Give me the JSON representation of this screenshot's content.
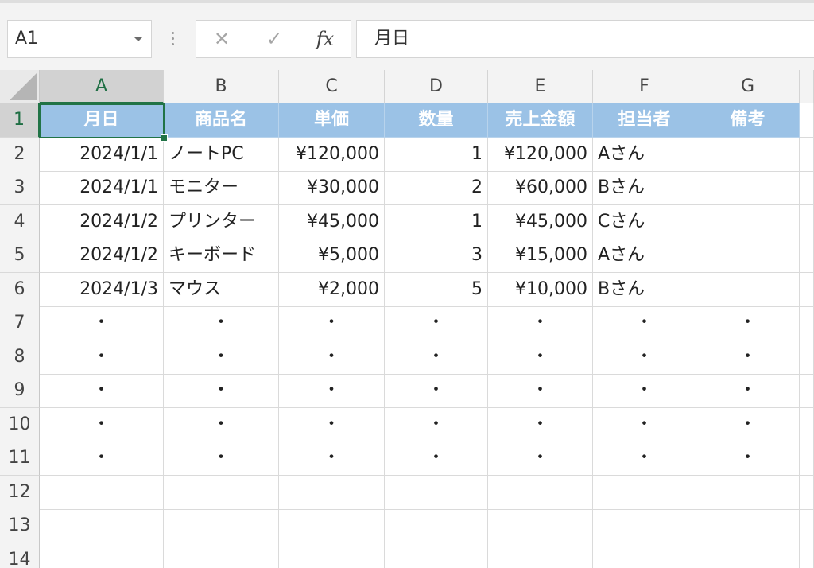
{
  "name_box": {
    "value": "A1",
    "dropdown_icon": "chevron-down-icon"
  },
  "formula_bar": {
    "cancel_symbol": "✕",
    "enter_symbol": "✓",
    "insert_function_symbol": "fx",
    "value": "月日"
  },
  "columns": [
    "A",
    "B",
    "C",
    "D",
    "E",
    "F",
    "G"
  ],
  "rows": [
    "1",
    "2",
    "3",
    "4",
    "5",
    "6",
    "7",
    "8",
    "9",
    "10",
    "11",
    "12",
    "13",
    "14"
  ],
  "selected_cell": "A1",
  "colors": {
    "header_fill": "#9bc2e6",
    "header_text": "#ffffff",
    "selection": "#217346"
  },
  "table": {
    "headers": [
      "月日",
      "商品名",
      "単価",
      "数量",
      "売上金額",
      "担当者",
      "備考"
    ],
    "rows": [
      [
        "2024/1/1",
        "ノートPC",
        "¥120,000",
        "1",
        "¥120,000",
        "Aさん",
        ""
      ],
      [
        "2024/1/1",
        "モニター",
        "¥30,000",
        "2",
        "¥60,000",
        "Bさん",
        ""
      ],
      [
        "2024/1/2",
        "プリンター",
        "¥45,000",
        "1",
        "¥45,000",
        "Cさん",
        ""
      ],
      [
        "2024/1/2",
        "キーボード",
        "¥5,000",
        "3",
        "¥15,000",
        "Aさん",
        ""
      ],
      [
        "2024/1/3",
        "マウス",
        "¥2,000",
        "5",
        "¥10,000",
        "Bさん",
        ""
      ],
      [
        "・",
        "・",
        "・",
        "・",
        "・",
        "・",
        "・"
      ],
      [
        "・",
        "・",
        "・",
        "・",
        "・",
        "・",
        "・"
      ],
      [
        "・",
        "・",
        "・",
        "・",
        "・",
        "・",
        "・"
      ],
      [
        "・",
        "・",
        "・",
        "・",
        "・",
        "・",
        "・"
      ],
      [
        "・",
        "・",
        "・",
        "・",
        "・",
        "・",
        "・"
      ]
    ]
  }
}
